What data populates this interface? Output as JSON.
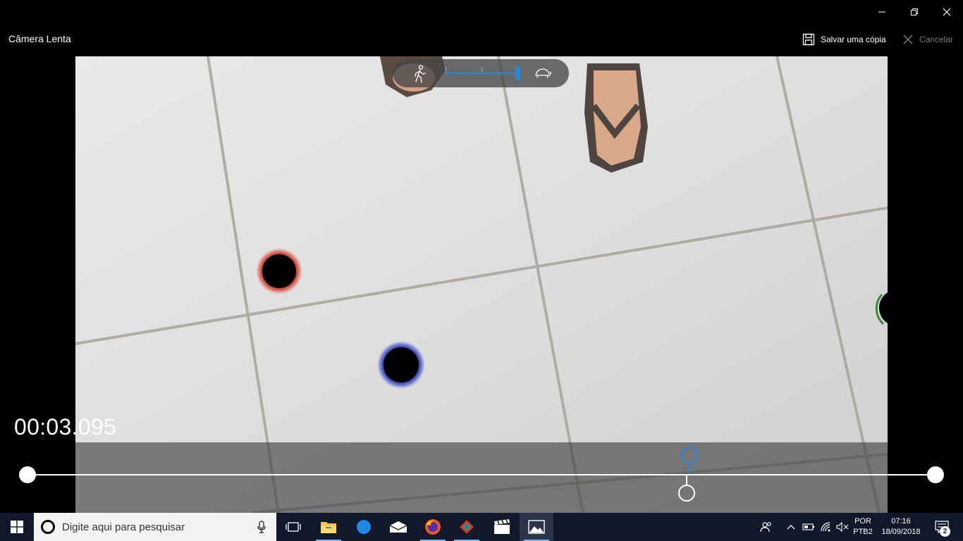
{
  "window": {
    "app_title": "Câmera Lenta"
  },
  "toolbar": {
    "save_label": "Salvar uma cópia",
    "cancel_label": "Cancelar"
  },
  "speed_control": {
    "icon_slow": "turtle-icon",
    "icon_normal": "walker-icon",
    "level": 1.0,
    "accent_color": "#1e88e5"
  },
  "player": {
    "timestamp": "00:03.095",
    "current_position": 0.726
  },
  "taskbar": {
    "search_placeholder": "Digite aqui para pesquisar",
    "language_line1": "POR",
    "language_line2": "PTB2",
    "time": "07:16",
    "date": "18/09/2018",
    "notification_count": "2",
    "background_color": "#101829"
  }
}
